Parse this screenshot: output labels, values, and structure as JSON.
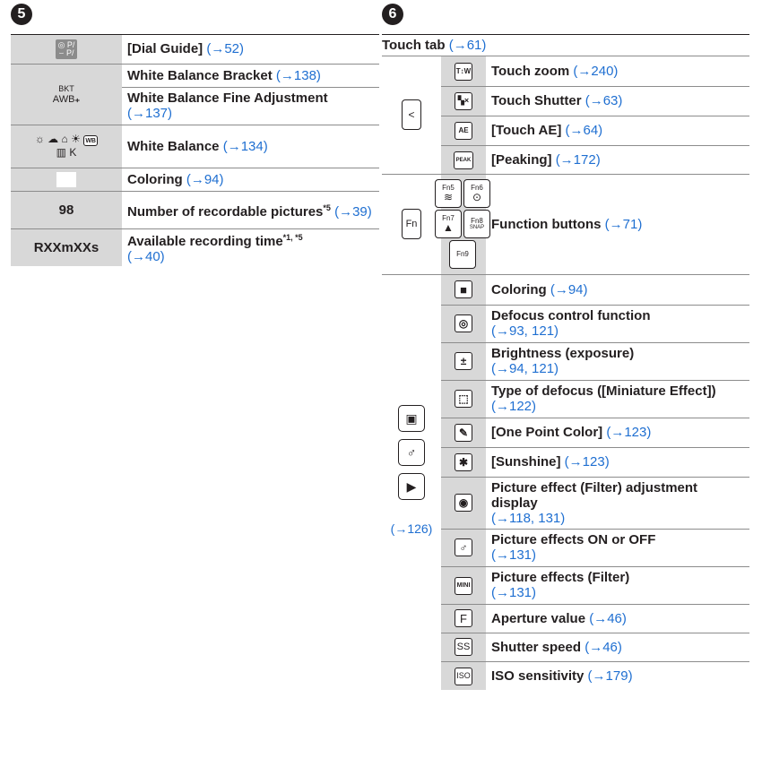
{
  "left": {
    "badge": "5",
    "rows": [
      {
        "icon_text": "P/",
        "desc": "[Dial Guide]",
        "ref": "(→52)"
      },
      {
        "icon_top": "BKT",
        "icon_bottom": "AWB",
        "desc": "White Balance Bracket",
        "ref": "(→138)"
      },
      {
        "desc": "White Balance Fine Adjustment",
        "ref": "(→137)"
      },
      {
        "icon_text": "☼ ☁ ⌂ ☀ ▣ ▤ ▥",
        "desc": "White Balance",
        "ref": "(→134)"
      },
      {
        "desc": "Coloring",
        "ref": "(→94)"
      },
      {
        "icon_text": "98",
        "desc": "Number of recordable pictures",
        "sup": "*5",
        "ref": "(→39)"
      },
      {
        "icon_text": "RXXmXXs",
        "desc": "Available recording time",
        "sup": "*1, *5",
        "ref": "(→40)"
      }
    ]
  },
  "right": {
    "badge": "6",
    "touch_tab_label": "Touch tab",
    "touch_tab_ref": "(→61)",
    "touch_rows": [
      {
        "desc": "Touch zoom",
        "ref": "(→240)",
        "icon": "T↕W"
      },
      {
        "desc": "Touch Shutter",
        "ref": "(→63)",
        "icon": "▚×"
      },
      {
        "desc": "[Touch AE]",
        "ref": "(→64)",
        "icon": "AE"
      },
      {
        "desc": "[Peaking]",
        "ref": "(→172)",
        "icon": "PEAK"
      }
    ],
    "fn_row": {
      "desc": "Function buttons",
      "ref": "(→71)",
      "side_icon": "Fn",
      "buttons": [
        {
          "label": "Fn5",
          "glyph": "≋"
        },
        {
          "label": "Fn6",
          "glyph": "⊙"
        },
        {
          "label": "Fn7",
          "glyph": "▲"
        },
        {
          "label": "Fn8",
          "glyph": "SNAP"
        },
        {
          "label": "Fn9",
          "glyph": ""
        }
      ]
    },
    "side_ref": "(→126)",
    "effect_rows": [
      {
        "desc": "Coloring",
        "ref": "(→94)",
        "icon": "■"
      },
      {
        "desc": "Defocus control function",
        "ref": "(→93, 121)",
        "icon": "◎"
      },
      {
        "desc": "Brightness (exposure)",
        "ref": "(→94, 121)",
        "icon": "±"
      },
      {
        "desc": "Type of defocus ([Miniature Effect])",
        "ref": "(→122)",
        "icon": "⬚"
      },
      {
        "desc": "[One Point Color]",
        "ref": "(→123)",
        "icon": "✎"
      },
      {
        "desc": "[Sunshine]",
        "ref": "(→123)",
        "icon": "✱"
      },
      {
        "desc": "Picture effect (Filter) adjustment display",
        "ref": "(→118, 131)",
        "icon": "◉"
      },
      {
        "desc": "Picture effects ON or OFF",
        "ref": "(→131)",
        "icon": "♂"
      },
      {
        "desc": "Picture effects (Filter)",
        "ref": "(→131)",
        "icon": "MINI"
      },
      {
        "desc": "Aperture value",
        "ref": "(→46)",
        "icon": "F"
      },
      {
        "desc": "Shutter speed",
        "ref": "(→46)",
        "icon": "SS"
      },
      {
        "desc": "ISO sensitivity",
        "ref": "(→179)",
        "icon": "ISO"
      }
    ]
  }
}
